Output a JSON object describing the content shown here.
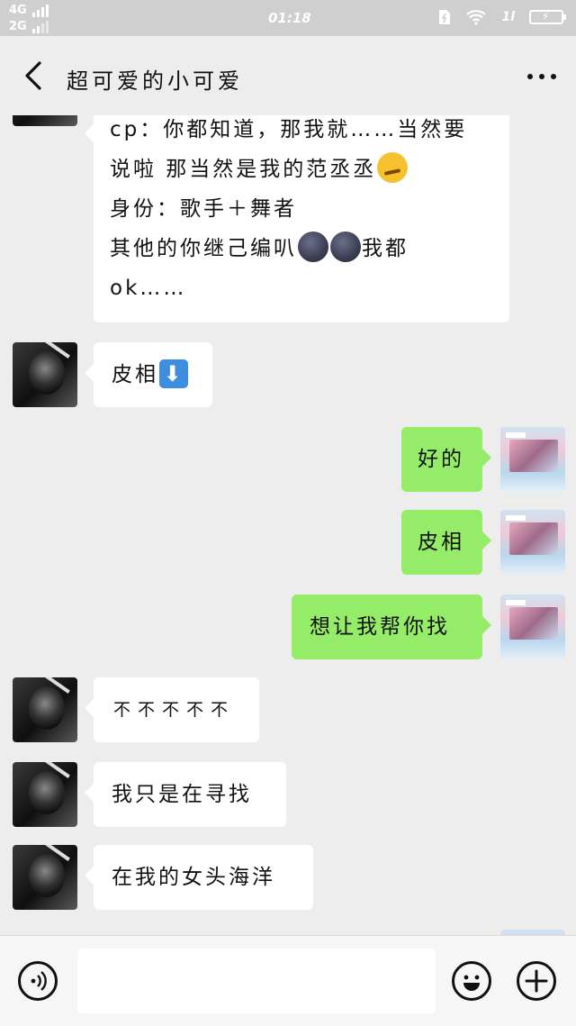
{
  "status_bar": {
    "network_1": "4G",
    "network_2": "2G",
    "time": "01:18",
    "mobile_signal": "1l",
    "battery_icon": "battery-charging-icon",
    "charge_glyph": "⚡"
  },
  "header": {
    "title": "超可爱的小可爱",
    "back_icon": "back-arrow-icon",
    "more_icon": "more-dots-icon"
  },
  "messages": [
    {
      "side": "in",
      "lines": [
        "cp：你都知道，那我就……当然要",
        "说啦 那当然是我的范丞丞",
        "身份：歌手＋舞者",
        "其他的你继己编叭",
        "ok……"
      ]
    },
    {
      "side": "in",
      "text": "皮相"
    },
    {
      "side": "out",
      "text": "好的"
    },
    {
      "side": "out",
      "text": "皮相"
    },
    {
      "side": "out",
      "text": "想让我帮你找"
    },
    {
      "side": "in",
      "text": "不不不不不"
    },
    {
      "side": "in",
      "text": "我只是在寻找"
    },
    {
      "side": "in",
      "text": "在我的女头海洋"
    }
  ],
  "extra_text": {
    "tail_1": "我都",
    "down_arrow": "⬇"
  },
  "input_bar": {
    "voice_icon": "voice-input-icon",
    "emoji_icon": "emoji-face-icon",
    "plus_icon": "add-plus-icon",
    "placeholder": ""
  },
  "colors": {
    "background": "#ededed",
    "bubble_in": "#ffffff",
    "bubble_out": "#95ec69"
  }
}
